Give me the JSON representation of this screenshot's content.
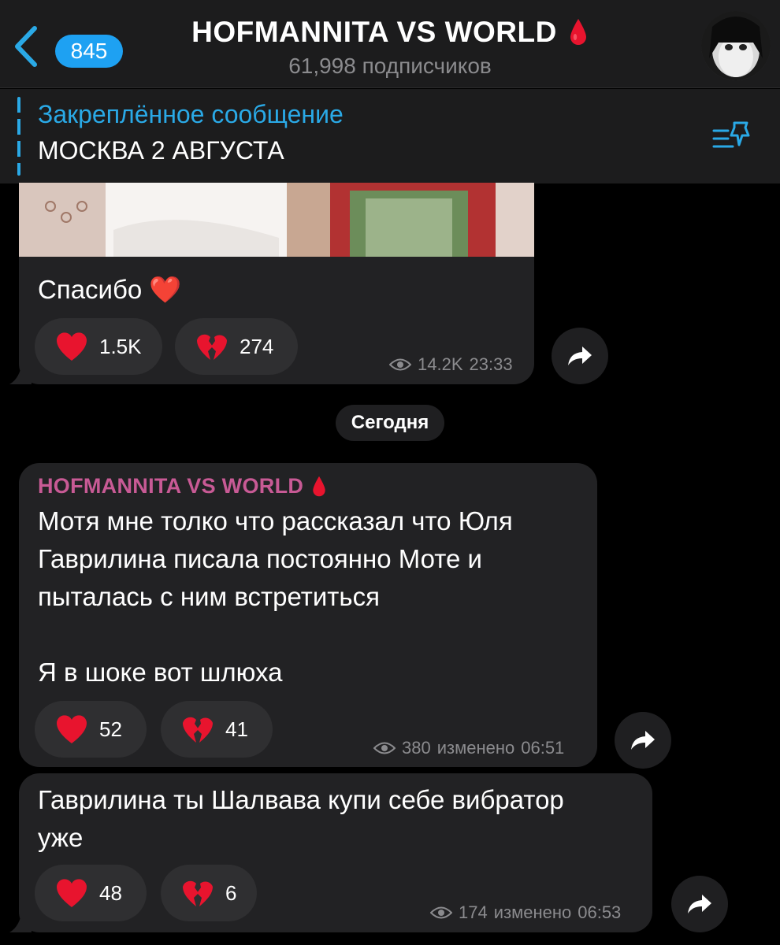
{
  "header": {
    "back_badge": "845",
    "title": "HOFMANNITA VS WORLD",
    "subscribers": "61,998 подписчиков"
  },
  "pinned": {
    "title": "Закреплённое сообщение",
    "text": "МОСКВА 2 АВГУСТА"
  },
  "messages": [
    {
      "text": "Спасибо ❤️",
      "reactions": [
        {
          "icon": "red-heart-icon",
          "count": "1.5K"
        },
        {
          "icon": "broken-heart-icon",
          "count": "274"
        }
      ],
      "views": "14.2K",
      "time": "23:33"
    },
    {
      "author": "HOFMANNITA VS WORLD",
      "text_lines": [
        "Мотя мне толко что рассказал что Юля",
        "Гаврилина писала постоянно Моте и",
        "пыталась с ним встретиться",
        "",
        "Я в шоке вот шлюха"
      ],
      "reactions": [
        {
          "icon": "red-heart-icon",
          "count": "52"
        },
        {
          "icon": "broken-heart-icon",
          "count": "41"
        }
      ],
      "views": "380",
      "edited": "изменено",
      "time": "06:51"
    },
    {
      "text_lines": [
        "Гаврилина ты Шалвава купи себе вибратор",
        "уже"
      ],
      "reactions": [
        {
          "icon": "red-heart-icon",
          "count": "48"
        },
        {
          "icon": "broken-heart-icon",
          "count": "6"
        }
      ],
      "views": "174",
      "edited": "изменено",
      "time": "06:53"
    }
  ],
  "date_separator": "Сегодня",
  "colors": {
    "accent": "#2aa9e6",
    "badge": "#1ea1f2",
    "author": "#c85a95",
    "bubble": "#222224",
    "heart": "#e8142e"
  }
}
